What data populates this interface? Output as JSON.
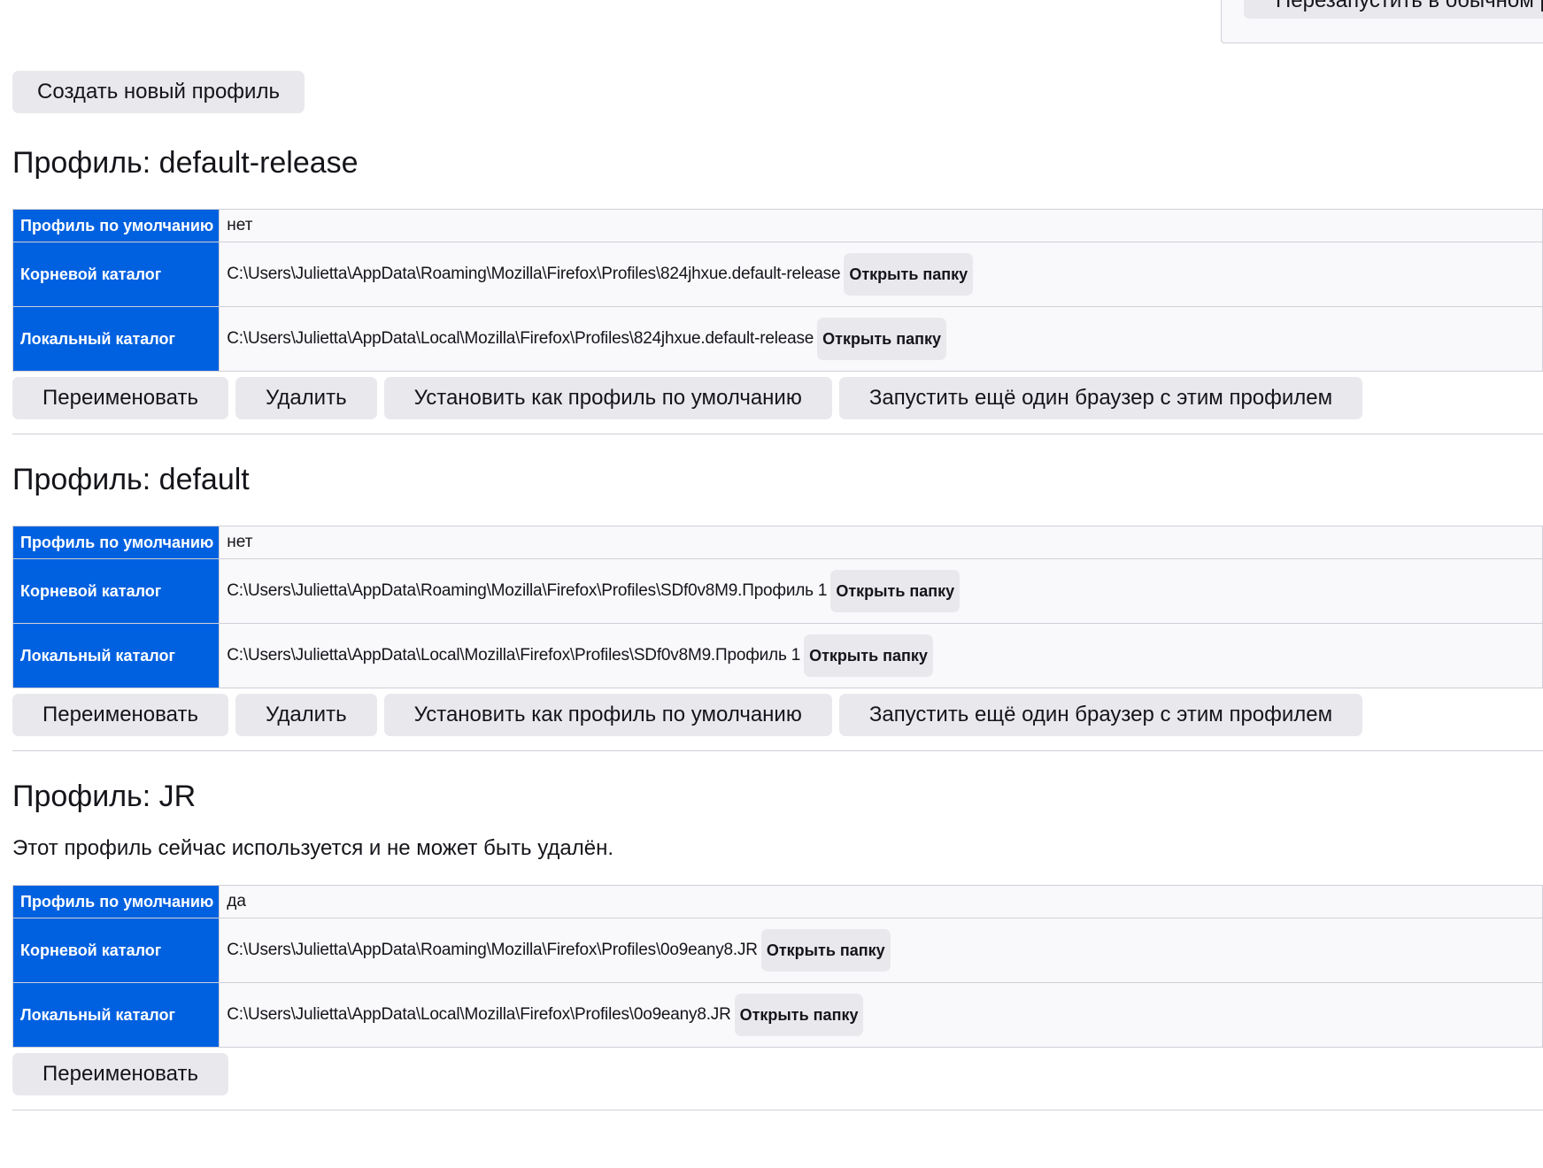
{
  "restart": {
    "label": "Перезапустить в обычном режиме"
  },
  "create_button": "Создать новый профиль",
  "labels": {
    "default_row": "Профиль по умолчанию",
    "root_dir": "Корневой каталог",
    "local_dir": "Локальный каталог",
    "open_folder": "Открыть папку"
  },
  "actions": {
    "rename": "Переименовать",
    "remove": "Удалить",
    "set_default": "Установить как профиль по умолчанию",
    "launch": "Запустить ещё один браузер с этим профилем"
  },
  "profiles": [
    {
      "title": "Профиль: default-release",
      "is_default": "нет",
      "root_dir": "C:\\Users\\Julietta\\AppData\\Roaming\\Mozilla\\Firefox\\Profiles\\824jhxue.default-release",
      "local_dir": "C:\\Users\\Julietta\\AppData\\Local\\Mozilla\\Firefox\\Profiles\\824jhxue.default-release"
    },
    {
      "title": "Профиль: default",
      "is_default": "нет",
      "root_dir": "C:\\Users\\Julietta\\AppData\\Roaming\\Mozilla\\Firefox\\Profiles\\SDf0v8M9.Профиль 1",
      "local_dir": "C:\\Users\\Julietta\\AppData\\Local\\Mozilla\\Firefox\\Profiles\\SDf0v8M9.Профиль 1"
    },
    {
      "title": "Профиль: JR",
      "notice": "Этот профиль сейчас используется и не может быть удалён.",
      "is_default": "да",
      "root_dir": "C:\\Users\\Julietta\\AppData\\Roaming\\Mozilla\\Firefox\\Profiles\\0o9eany8.JR",
      "local_dir": "C:\\Users\\Julietta\\AppData\\Local\\Mozilla\\Firefox\\Profiles\\0o9eany8.JR"
    }
  ]
}
